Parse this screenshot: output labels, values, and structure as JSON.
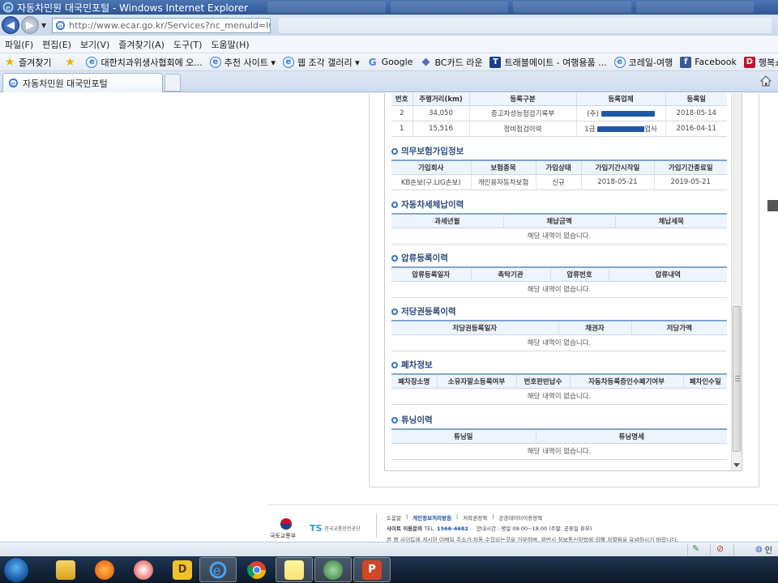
{
  "window": {
    "title": "자동차민원 대국민포털 - Windows Internet Explorer",
    "url": "http://www.ecar.go.kr/Services?nc_menuId=IQN000#;"
  },
  "menubar": [
    "파일(F)",
    "편집(E)",
    "보기(V)",
    "즐겨찾기(A)",
    "도구(T)",
    "도움말(H)"
  ],
  "favorites": {
    "label": "즐겨찾기",
    "items": [
      {
        "label": "대한치과위생사협회에 오...",
        "icon": "ie-page-icon"
      },
      {
        "label": "추천 사이트 ▾",
        "icon": "ie-page-icon"
      },
      {
        "label": "웹 조각 갤러리 ▾",
        "icon": "web-slice-icon"
      },
      {
        "label": "Google",
        "icon": "google-icon"
      },
      {
        "label": "BC카드 라운",
        "icon": "bc-card-icon"
      },
      {
        "label": "트래블메이트 - 여행용품 ...",
        "icon": "travelmate-icon"
      },
      {
        "label": "코레일-여행",
        "icon": "ie-page-icon"
      },
      {
        "label": "Facebook",
        "icon": "facebook-icon"
      },
      {
        "label": "행복쇼핑의 시작",
        "icon": "shopping-icon"
      }
    ]
  },
  "tab": {
    "label": "자동차민원 대국민포털"
  },
  "sections": {
    "inspection": {
      "headers": [
        "번호",
        "주행거리(km)",
        "등록구분",
        "등록업체",
        "등록일"
      ],
      "rows": [
        {
          "no": "2",
          "distance": "34,050",
          "type": "중고차성능점검기록부",
          "company": "(주)",
          "date": "2018-05-14"
        },
        {
          "no": "1",
          "distance": "15,516",
          "type": "정비점검이력",
          "company_prefix": "1급",
          "company_suffix": "업사",
          "date": "2016-04-11"
        }
      ]
    },
    "insurance": {
      "title": "의무보험가입정보",
      "headers": [
        "가입회사",
        "보험종목",
        "가입상태",
        "가입기간시작일",
        "가입기간종료일"
      ],
      "row": [
        "KB손보(구.LIG손보)",
        "개인용자동차보험",
        "신규",
        "2018-05-21",
        "2019-05-21"
      ]
    },
    "tax": {
      "title": "자동차세체납이력",
      "headers": [
        "과세년월",
        "체납금액",
        "체납세목"
      ],
      "empty": "해당 내역이 없습니다."
    },
    "seizure": {
      "title": "압류등록이력",
      "headers": [
        "압류등록일자",
        "촉탁기관",
        "압류번호",
        "압류내역"
      ],
      "empty": "해당 내역이 없습니다."
    },
    "mortgage": {
      "title": "저당권등록이력",
      "headers": [
        "저당권등록일자",
        "채권자",
        "저당가액"
      ],
      "empty": "해당 내역이 없습니다."
    },
    "scrap": {
      "title": "폐차정보",
      "headers": [
        "폐차장소명",
        "소유자말소등록여부",
        "번호판반납수",
        "자동차등록증인수폐기여부",
        "폐차인수일"
      ],
      "empty": "해당 내역이 없습니다."
    },
    "tuning": {
      "title": "튜닝이력",
      "headers": [
        "튜닝일",
        "튜닝명세"
      ],
      "empty": "해당 내역이 없습니다."
    }
  },
  "footer": {
    "logo_ministry": "국토교통부",
    "logo_ts": "TS",
    "logo_ts_sub": "한국교통안전공단",
    "links": [
      "도움말",
      "개인정보처리방침",
      "저작권정책",
      "공공데이터이용정책"
    ],
    "contact_label": "사이트 이용문의",
    "tel_label": "TEL.",
    "tel": "1566-4682",
    "hours": "안내시간 : 평일 09:00~18:00 (주말, 공휴일 휴무)",
    "notice": "본 웹 사이트에 게시된 이메일 주소가 자동 수집되는것을 거부하며, 위반시 정보통신망법에 의해 처벌됨을 유념하시기 바랍니다."
  },
  "statusbar": {
    "zone": "인"
  },
  "taskbar": {
    "items": [
      "windows-explorer-icon",
      "media-player-icon",
      "gom-player-icon",
      "dictionary-icon",
      "internet-explorer-icon",
      "chrome-icon",
      "sticky-notes-icon",
      "network-icon",
      "powerpoint-icon"
    ],
    "dictionary_letter": "D",
    "powerpoint_letter": "P"
  },
  "colors": {
    "accent": "#2f74c9",
    "header_line": "#7fa6cf",
    "redaction": "#1f57a8"
  }
}
